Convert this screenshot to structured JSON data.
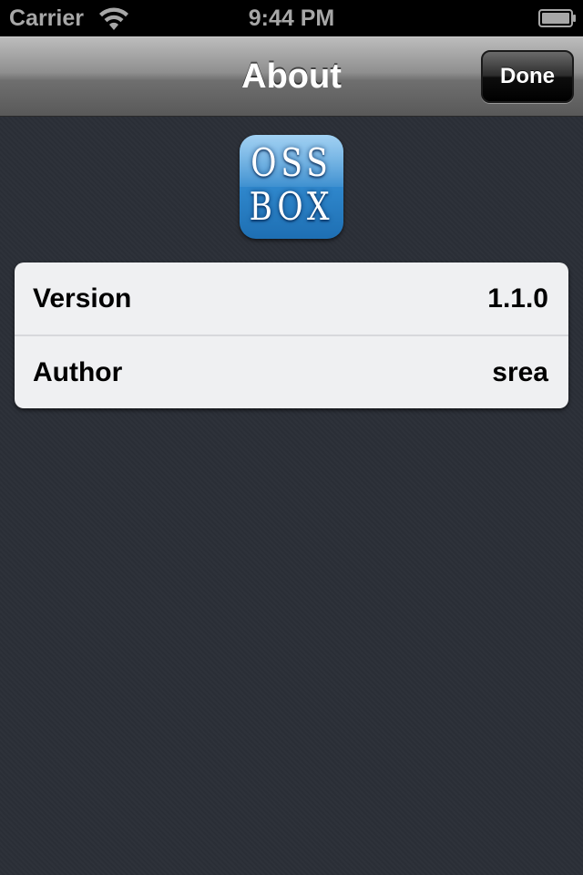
{
  "status_bar": {
    "carrier": "Carrier",
    "time": "9:44 PM",
    "icons": [
      "wifi-icon",
      "battery-icon"
    ]
  },
  "nav_bar": {
    "title": "About",
    "done_label": "Done"
  },
  "app_icon": {
    "line1": "OSS",
    "line2": "BOX",
    "color": "#2f87cc"
  },
  "info": {
    "rows": [
      {
        "label": "Version",
        "value": "1.1.0"
      },
      {
        "label": "Author",
        "value": "srea"
      }
    ]
  },
  "colors": {
    "background": "#2c3038",
    "table": "#eff0f2",
    "status_bar": "#000000"
  }
}
